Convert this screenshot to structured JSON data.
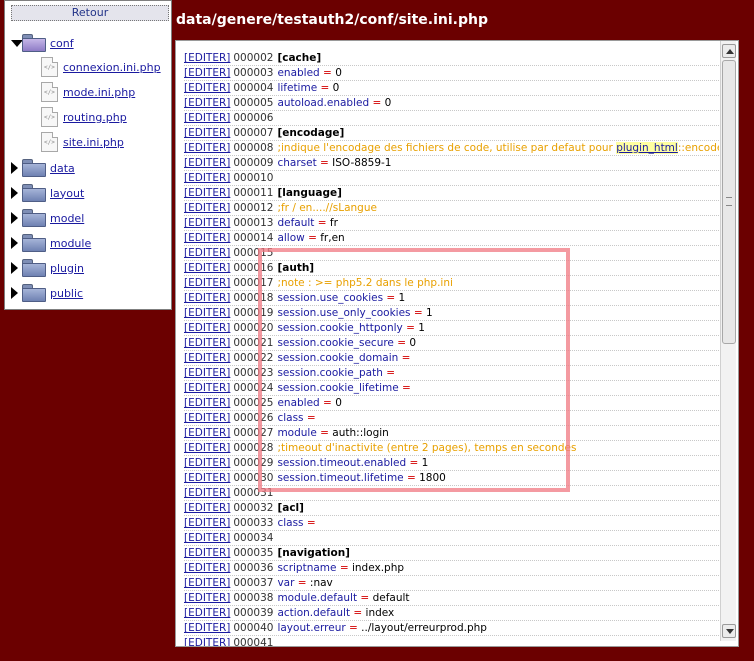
{
  "nav": {
    "back_label": "Retour"
  },
  "tree": {
    "open_folder": "conf",
    "files": [
      "connexion.ini.php",
      "mode.ini.php",
      "routing.php",
      "site.ini.php"
    ],
    "folders": [
      "data",
      "layout",
      "model",
      "module",
      "plugin",
      "public"
    ]
  },
  "page_title": "data/genere/testauth2/conf/site.ini.php",
  "edit_label": "[EDITER]",
  "lines": [
    {
      "num": "000002",
      "type": "section",
      "text": "[cache]"
    },
    {
      "num": "000003",
      "type": "kv",
      "key": "enabled",
      "value": "0"
    },
    {
      "num": "000004",
      "type": "kv",
      "key": "lifetime",
      "value": "0"
    },
    {
      "num": "000005",
      "type": "kv",
      "key": "autoload.enabled",
      "value": "0"
    },
    {
      "num": "000006",
      "type": "blank"
    },
    {
      "num": "000007",
      "type": "section",
      "text": "[encodage]"
    },
    {
      "num": "000008",
      "type": "comment_link",
      "text": ";indique l'encodage des fichiers de code, utilise par defaut pour ",
      "link": "plugin_html",
      "after": "::encode($texte)"
    },
    {
      "num": "000009",
      "type": "kv",
      "key": "charset",
      "value": "ISO-8859-1"
    },
    {
      "num": "000010",
      "type": "blank"
    },
    {
      "num": "000011",
      "type": "section",
      "text": "[language]"
    },
    {
      "num": "000012",
      "type": "comment",
      "text": ";fr / en....//sLangue"
    },
    {
      "num": "000013",
      "type": "kv",
      "key": "default",
      "value": "fr"
    },
    {
      "num": "000014",
      "type": "kv",
      "key": "allow",
      "value": "fr,en"
    },
    {
      "num": "000015",
      "type": "blank"
    },
    {
      "num": "000016",
      "type": "section",
      "text": "[auth]"
    },
    {
      "num": "000017",
      "type": "comment",
      "text": ";note : >= php5.2 dans le php.ini"
    },
    {
      "num": "000018",
      "type": "kv",
      "key": "session.use_cookies",
      "value": "1"
    },
    {
      "num": "000019",
      "type": "kv",
      "key": "session.use_only_cookies",
      "value": "1"
    },
    {
      "num": "000020",
      "type": "kv",
      "key": "session.cookie_httponly",
      "value": "1"
    },
    {
      "num": "000021",
      "type": "kv",
      "key": "session.cookie_secure",
      "value": "0"
    },
    {
      "num": "000022",
      "type": "kv",
      "key": "session.cookie_domain",
      "value": ""
    },
    {
      "num": "000023",
      "type": "kv",
      "key": "session.cookie_path",
      "value": ""
    },
    {
      "num": "000024",
      "type": "kv",
      "key": "session.cookie_lifetime",
      "value": ""
    },
    {
      "num": "000025",
      "type": "kv",
      "key": "enabled",
      "value": "0"
    },
    {
      "num": "000026",
      "type": "kv",
      "key": "class",
      "value": ""
    },
    {
      "num": "000027",
      "type": "kv",
      "key": "module",
      "value": "auth::login"
    },
    {
      "num": "000028",
      "type": "comment",
      "text": ";timeout d'inactivite (entre 2 pages), temps en secondes"
    },
    {
      "num": "000029",
      "type": "kv",
      "key": "session.timeout.enabled",
      "value": "1"
    },
    {
      "num": "000030",
      "type": "kv",
      "key": "session.timeout.lifetime",
      "value": "1800"
    },
    {
      "num": "000031",
      "type": "blank"
    },
    {
      "num": "000032",
      "type": "section",
      "text": "[acl]"
    },
    {
      "num": "000033",
      "type": "kv",
      "key": "class",
      "value": ""
    },
    {
      "num": "000034",
      "type": "blank"
    },
    {
      "num": "000035",
      "type": "section",
      "text": "[navigation]"
    },
    {
      "num": "000036",
      "type": "kv",
      "key": "scriptname",
      "value": "index.php"
    },
    {
      "num": "000037",
      "type": "kv",
      "key": "var",
      "value": ":nav"
    },
    {
      "num": "000038",
      "type": "kv",
      "key": "module.default",
      "value": "default"
    },
    {
      "num": "000039",
      "type": "kv",
      "key": "action.default",
      "value": "index"
    },
    {
      "num": "000040",
      "type": "kv",
      "key": "layout.erreur",
      "value": "../layout/erreurprod.php"
    },
    {
      "num": "000041",
      "type": "blank"
    }
  ]
}
